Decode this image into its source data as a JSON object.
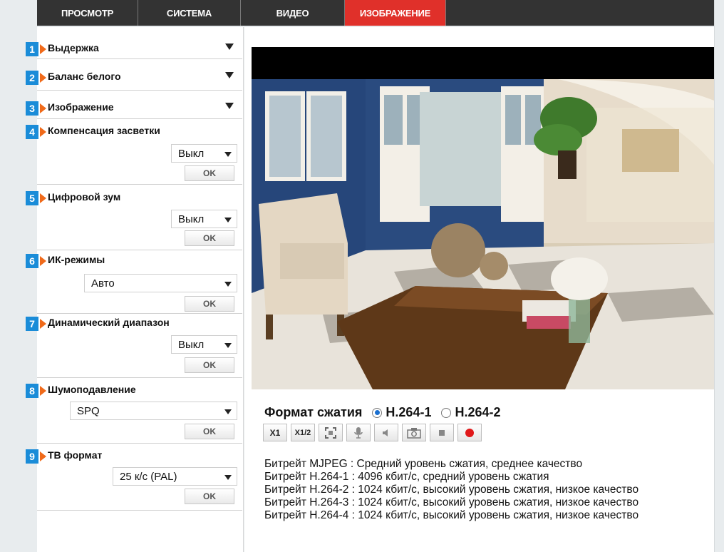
{
  "tabs": [
    {
      "label": "ПРОСМОТР",
      "active": false
    },
    {
      "label": "СИСТЕМА",
      "active": false
    },
    {
      "label": "ВИДЕО",
      "active": false
    },
    {
      "label": "ИЗОБРАЖЕНИЕ",
      "active": true
    }
  ],
  "sections": [
    {
      "num": "1",
      "title": "Выдержка"
    },
    {
      "num": "2",
      "title": "Баланс белого"
    },
    {
      "num": "3",
      "title": "Изображение"
    },
    {
      "num": "4",
      "title": "Компенсация засветки",
      "value": "Выкл",
      "ok": "OK"
    },
    {
      "num": "5",
      "title": "Цифровой зум",
      "value": "Выкл",
      "ok": "OK"
    },
    {
      "num": "6",
      "title": "ИК-режимы",
      "value": "Авто",
      "ok": "OK"
    },
    {
      "num": "7",
      "title": "Динамический диапазон",
      "value": "Выкл",
      "ok": "OK"
    },
    {
      "num": "8",
      "title": "Шумоподавление",
      "value": "SPQ",
      "ok": "OK"
    },
    {
      "num": "9",
      "title": "ТВ формат",
      "value": "25 к/с (PAL)",
      "ok": "OK"
    }
  ],
  "format": {
    "label": "Формат сжатия",
    "options": [
      "H.264-1",
      "H.264-2"
    ],
    "selected": "H.264-1"
  },
  "controls": {
    "x1": "X1",
    "x12": "X1/2"
  },
  "bitrates": [
    "Битрейт MJPEG : Средний уровень сжатия, среднее качество",
    "Битрейт H.264-1 : 4096 кбит/с, средний уровень сжатия",
    "Битрейт H.264-2 : 1024 кбит/с, высокий уровень сжатия, низкое качество",
    "Битрейт H.264-3 : 1024 кбит/с, высокий уровень сжатия, низкое качество",
    "Битрейт H.264-4 : 1024 кбит/с, высокий уровень сжатия, низкое качество"
  ],
  "colors": {
    "accent": "#e0302a",
    "nav": "#333333",
    "badge": "#1a8cd8",
    "badge_arrow": "#f06a1a"
  }
}
